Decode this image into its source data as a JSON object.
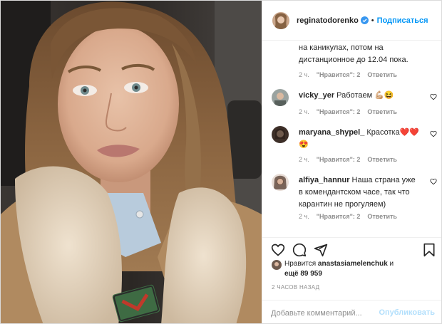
{
  "post": {
    "author": "reginatodorenko",
    "follow_label": "Подписаться",
    "dot": "•"
  },
  "comments": {
    "continuation_text": "на каникулах, потом на дистанционное до 12.04 пока.",
    "continuation_meta": {
      "time": "2 ч.",
      "likes": "\"Нравится\": 2",
      "reply": "Ответить"
    },
    "items": [
      {
        "user": "vicky_yer",
        "text": "Работаем 💪🏼😆",
        "time": "2 ч.",
        "likes": "\"Нравится\": 2",
        "reply": "Ответить"
      },
      {
        "user": "maryana_shypel_",
        "text": "Красотка❤️❤️😍",
        "time": "2 ч.",
        "likes": "\"Нравится\": 2",
        "reply": "Ответить"
      },
      {
        "user": "alfiya_hannur",
        "text": "Наша страна уже в комендантском часе, так что карантин не прогуляем)",
        "time": "2 ч.",
        "likes": "\"Нравится\": 2",
        "reply": "Ответить"
      }
    ]
  },
  "likes": {
    "prefix": "Нравится",
    "user": "anastasiamelenchuk",
    "conj": "и",
    "more": "ещё 89 959"
  },
  "timeago": "2 часов назад",
  "add_comment": {
    "placeholder": "Добавьте комментарий...",
    "post_label": "Опубликовать"
  },
  "colors": {
    "link_blue": "#0095f6",
    "post_disabled": "#b2dffc",
    "meta_gray": "#8e8e8e",
    "text": "#262626",
    "verified_blue": "#3897f0",
    "heart_red": "#e0245e"
  },
  "icons": [
    "verified-badge-icon",
    "heart-outline-icon",
    "comment-icon",
    "share-icon",
    "bookmark-icon"
  ]
}
